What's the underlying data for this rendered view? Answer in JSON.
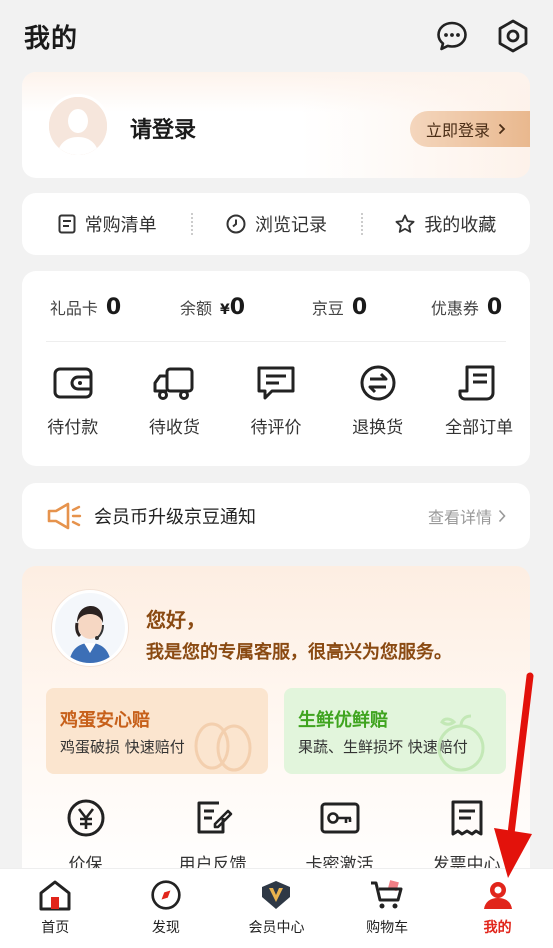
{
  "header": {
    "title": "我的",
    "icons": [
      "message-icon",
      "settings-icon"
    ]
  },
  "login": {
    "prompt": "请登录",
    "button": "立即登录"
  },
  "quick_links": [
    {
      "label": "常购清单",
      "icon": "list-icon"
    },
    {
      "label": "浏览记录",
      "icon": "clock-icon"
    },
    {
      "label": "我的收藏",
      "icon": "star-icon"
    }
  ],
  "stats": [
    {
      "label": "礼品卡",
      "value": "0"
    },
    {
      "label": "余额",
      "prefix": "¥",
      "value": "0"
    },
    {
      "label": "京豆",
      "value": "0"
    },
    {
      "label": "优惠券",
      "value": "0"
    }
  ],
  "orders": [
    {
      "label": "待付款",
      "icon": "wallet-icon"
    },
    {
      "label": "待收货",
      "icon": "truck-icon"
    },
    {
      "label": "待评价",
      "icon": "comment-icon"
    },
    {
      "label": "退换货",
      "icon": "exchange-icon"
    },
    {
      "label": "全部订单",
      "icon": "orders-icon"
    }
  ],
  "notice": {
    "text": "会员币升级京豆通知",
    "more": "查看详情"
  },
  "service": {
    "greeting": "您好，",
    "intro": "我是您的专属客服，很高兴为您服务。",
    "promos": [
      {
        "title": "鸡蛋安心赔",
        "subtitle": "鸡蛋破损 快速赔付"
      },
      {
        "title": "生鲜优鲜赔",
        "subtitle": "果蔬、生鲜损坏 快速赔付"
      }
    ],
    "items": [
      {
        "label": "价保",
        "icon": "price-protect-icon"
      },
      {
        "label": "用户反馈",
        "icon": "feedback-icon"
      },
      {
        "label": "卡密激活",
        "icon": "key-icon"
      },
      {
        "label": "发票中心",
        "icon": "invoice-icon"
      }
    ]
  },
  "tabs": [
    {
      "label": "首页",
      "icon": "home-icon"
    },
    {
      "label": "发现",
      "icon": "compass-icon"
    },
    {
      "label": "会员中心",
      "icon": "vip-icon"
    },
    {
      "label": "购物车",
      "icon": "cart-icon"
    },
    {
      "label": "我的",
      "icon": "profile-icon",
      "active": true
    }
  ],
  "colors": {
    "accent": "#e1251b",
    "gold": "#8a4a12",
    "egg": "#c7601a",
    "fresh": "#3fa41f"
  }
}
